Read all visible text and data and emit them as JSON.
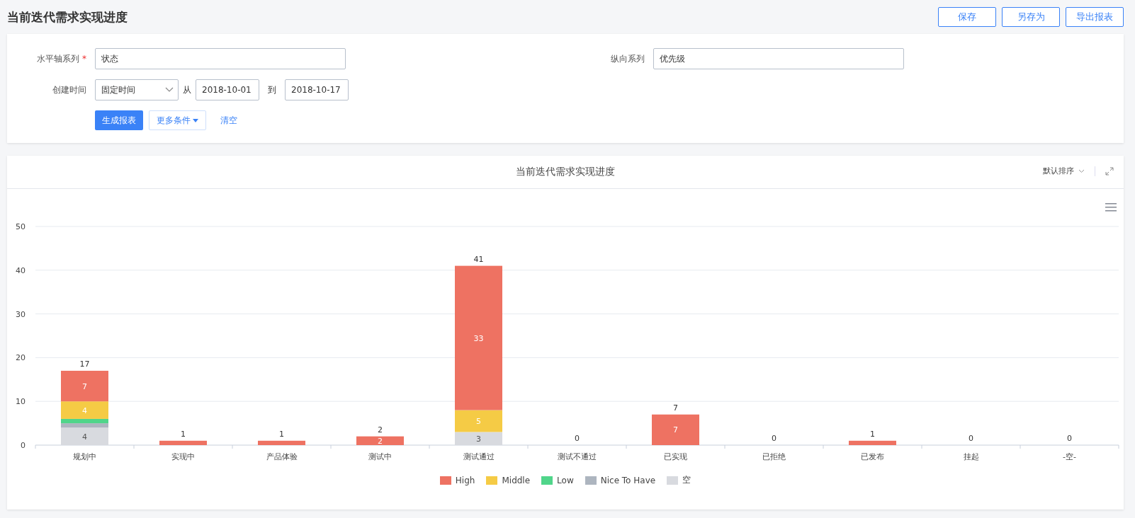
{
  "page": {
    "title": "当前迭代需求实现进度"
  },
  "actions": [
    {
      "label": "保存"
    },
    {
      "label": "另存为"
    },
    {
      "label": "导出报表"
    }
  ],
  "form": {
    "horizontal_axis": {
      "label": "水平轴系列",
      "required_mark": "*",
      "value": "状态"
    },
    "vertical_series": {
      "label": "纵向系列",
      "value": "优先级"
    },
    "created_time": {
      "label": "创建时间",
      "mode": "固定时间",
      "from_label": "从",
      "from": "2018-10-01",
      "to_label": "到",
      "to": "2018-10-17"
    },
    "buttons": {
      "generate": "生成报表",
      "more": "更多条件",
      "clear": "清空"
    }
  },
  "chart_panel": {
    "title": "当前迭代需求实现进度",
    "sort": "默认排序",
    "chart_data": {
      "type": "bar",
      "stacked": true,
      "grid": true,
      "legend": "bottom",
      "ylim": [
        0,
        50
      ],
      "yticks": [
        0,
        10,
        20,
        30,
        40,
        50
      ],
      "categories": [
        "规划中",
        "实现中",
        "产品体验",
        "测试中",
        "测试通过",
        "测试不通过",
        "已实现",
        "已拒绝",
        "已发布",
        "挂起",
        "-空-"
      ],
      "series": [
        {
          "name": "High",
          "color": "#ee7262",
          "values": [
            7,
            1,
            1,
            2,
            33,
            0,
            7,
            0,
            1,
            0,
            0
          ],
          "value_labels": [
            "7",
            null,
            null,
            "2",
            "33",
            null,
            "7",
            null,
            null,
            null,
            null
          ]
        },
        {
          "name": "Middle",
          "color": "#f5cb45",
          "values": [
            4,
            0,
            0,
            0,
            5,
            0,
            0,
            0,
            0,
            0,
            0
          ],
          "value_labels": [
            "4",
            null,
            null,
            null,
            "5",
            null,
            null,
            null,
            null,
            null,
            null
          ]
        },
        {
          "name": "Low",
          "color": "#50d58a",
          "values": [
            1,
            0,
            0,
            0,
            0,
            0,
            0,
            0,
            0,
            0,
            0
          ],
          "value_labels": [
            null,
            null,
            null,
            null,
            null,
            null,
            null,
            null,
            null,
            null,
            null
          ]
        },
        {
          "name": "Nice To Have",
          "color": "#adb5bf",
          "values": [
            1,
            0,
            0,
            0,
            0,
            0,
            0,
            0,
            0,
            0,
            0
          ],
          "value_labels": [
            null,
            null,
            null,
            null,
            null,
            null,
            null,
            null,
            null,
            null,
            null
          ]
        },
        {
          "name": "空",
          "color": "#d8dadf",
          "values": [
            4,
            0,
            0,
            0,
            3,
            0,
            0,
            0,
            0,
            0,
            0
          ],
          "value_labels": [
            "4",
            null,
            null,
            null,
            "3",
            null,
            null,
            null,
            null,
            null,
            null
          ]
        }
      ],
      "annotations": [
        "17",
        "1",
        "1",
        "2",
        "41",
        "0",
        "7",
        "0",
        "1",
        "0",
        "0"
      ]
    }
  }
}
